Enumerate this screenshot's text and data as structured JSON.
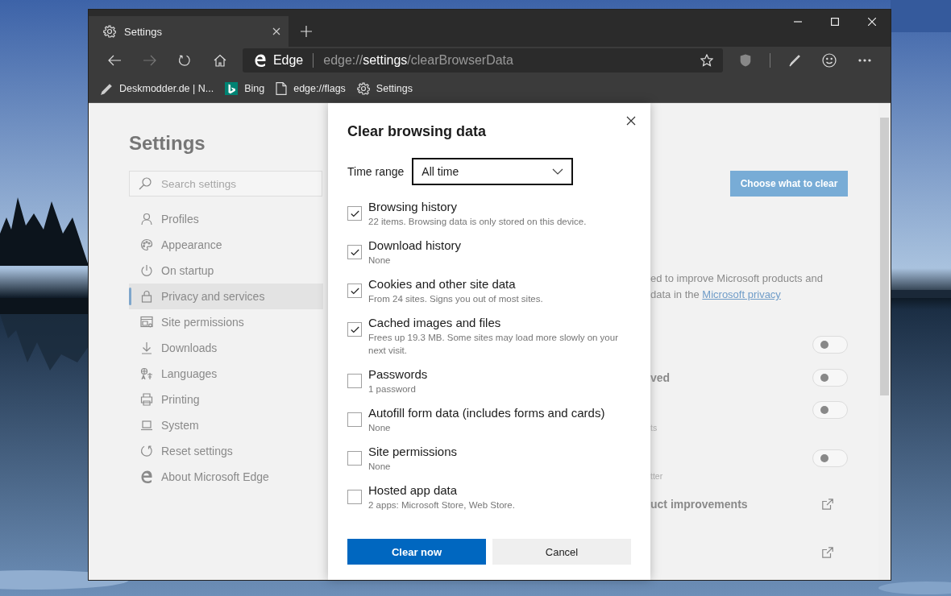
{
  "browser": {
    "tab_title": "Settings",
    "brand": "Edge",
    "url": "edge://**settings**/clearBrowserData"
  },
  "bookmarks": [
    {
      "label": "Deskmodder.de | N...",
      "kind": "pen"
    },
    {
      "label": "Bing",
      "kind": "bing"
    },
    {
      "label": "edge://flags",
      "kind": "page"
    },
    {
      "label": "Settings",
      "kind": "gear"
    }
  ],
  "sidebar": {
    "title": "Settings",
    "search": {
      "placeholder": "Search settings"
    },
    "items": [
      {
        "label": "Profiles",
        "kind": "person",
        "selected": false
      },
      {
        "label": "Appearance",
        "kind": "palette",
        "selected": false
      },
      {
        "label": "On startup",
        "kind": "power",
        "selected": false
      },
      {
        "label": "Privacy and services",
        "kind": "lock",
        "selected": true
      },
      {
        "label": "Site permissions",
        "kind": "sitegrid",
        "selected": false
      },
      {
        "label": "Downloads",
        "kind": "download",
        "selected": false
      },
      {
        "label": "Languages",
        "kind": "language",
        "selected": false
      },
      {
        "label": "Printing",
        "kind": "printer",
        "selected": false
      },
      {
        "label": "System",
        "kind": "laptop",
        "selected": false
      },
      {
        "label": "Reset settings",
        "kind": "reset",
        "selected": false
      },
      {
        "label": "About Microsoft Edge",
        "kind": "edge",
        "selected": false
      }
    ]
  },
  "main": {
    "choose_button": "Choose what to clear",
    "notice": {
      "line1": "ed to improve Microsoft products and",
      "line2": "data in the",
      "link": "Microsoft privacy"
    },
    "toggles": [
      {
        "on": false
      },
      {
        "label": "ved",
        "on": false
      },
      {
        "caption": "ts",
        "on": false
      },
      {
        "caption": "tter",
        "on": false
      }
    ],
    "external_links": [
      {
        "kind": "labelled",
        "label": "uct improvements"
      },
      {
        "kind": "icon_only"
      }
    ]
  },
  "dialog": {
    "title": "Clear browsing data",
    "time_range": {
      "label": "Time range",
      "value": "All time"
    },
    "options": [
      {
        "label": "Browsing history",
        "detail": "22 items. Browsing data is only stored on this device.",
        "checked": true
      },
      {
        "label": "Download history",
        "detail": "None",
        "checked": true
      },
      {
        "label": "Cookies and other site data",
        "detail": "From 24 sites. Signs you out of most sites.",
        "checked": true
      },
      {
        "label": "Cached images and files",
        "detail": "Frees up 19.3 MB. Some sites may load more slowly on your next visit.",
        "checked": true
      },
      {
        "label": "Passwords",
        "detail": "1 password",
        "checked": false
      },
      {
        "label": "Autofill form data (includes forms and cards)",
        "detail": "None",
        "checked": false
      },
      {
        "label": "Site permissions",
        "detail": "None",
        "checked": false
      },
      {
        "label": "Hosted app data",
        "detail": "2 apps: Microsoft Store, Web Store.",
        "checked": false
      }
    ],
    "buttons": [
      {
        "label": "Clear now",
        "kind": "primary"
      },
      {
        "label": "Cancel",
        "kind": "secondary"
      }
    ]
  }
}
